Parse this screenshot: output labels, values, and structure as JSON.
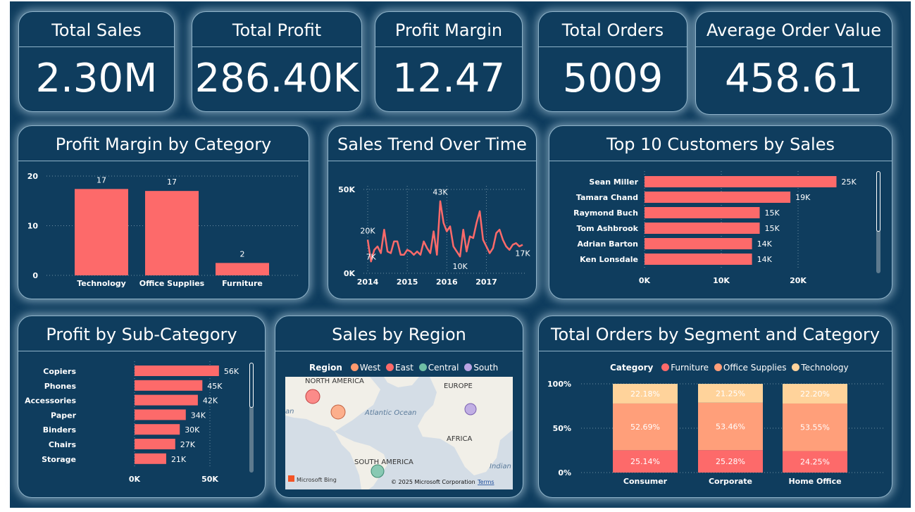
{
  "kpis": [
    {
      "title": "Total Sales",
      "value": "2.30M"
    },
    {
      "title": "Total Profit",
      "value": "286.40K"
    },
    {
      "title": "Profit Margin",
      "value": "12.47"
    },
    {
      "title": "Total Orders",
      "value": "5009"
    },
    {
      "title": "Average Order Value",
      "value": "458.61"
    }
  ],
  "colors": {
    "background": "#0f3d5e",
    "bar": "#fd6a6a",
    "west": "#ff9a6e",
    "east": "#fd6a6a",
    "central": "#6fbfa5",
    "south": "#b9a3e3",
    "office": "#ff9f7a",
    "tech": "#ffd39b"
  },
  "chart_data": [
    {
      "title": "Profit Margin by Category",
      "type": "bar",
      "categories": [
        "Technology",
        "Office Supplies",
        "Furniture"
      ],
      "values": [
        17.4,
        17.0,
        2.5
      ],
      "data_labels": [
        "17",
        "17",
        "2"
      ],
      "yticks": [
        "0",
        "10",
        "20"
      ],
      "ylim": [
        0,
        20
      ]
    },
    {
      "title": "Sales Trend Over Time",
      "type": "line",
      "x": [
        "2014-01",
        "2014-02",
        "2014-03",
        "2014-04",
        "2014-05",
        "2014-06",
        "2014-07",
        "2014-08",
        "2014-09",
        "2014-10",
        "2014-11",
        "2014-12",
        "2015-01",
        "2015-02",
        "2015-03",
        "2015-04",
        "2015-05",
        "2015-06",
        "2015-07",
        "2015-08",
        "2015-09",
        "2015-10",
        "2015-11",
        "2015-12",
        "2016-01",
        "2016-02",
        "2016-03",
        "2016-04",
        "2016-05",
        "2016-06",
        "2016-07",
        "2016-08",
        "2016-09",
        "2016-10",
        "2016-11",
        "2016-12",
        "2017-01",
        "2017-02",
        "2017-03",
        "2017-04",
        "2017-05",
        "2017-06",
        "2017-07",
        "2017-08",
        "2017-09",
        "2017-10",
        "2017-11",
        "2017-12"
      ],
      "values": [
        20,
        7,
        14,
        16,
        12,
        26,
        13,
        12,
        19,
        19,
        11,
        11,
        14,
        13,
        11,
        13,
        11,
        19,
        15,
        12,
        25,
        11,
        43,
        30,
        25,
        28,
        16,
        13,
        10,
        26,
        13,
        22,
        21,
        30,
        37,
        20,
        16,
        12,
        15,
        24,
        26,
        20,
        16,
        14,
        17,
        18,
        16,
        17
      ],
      "data_labels": [
        "20K",
        "7K",
        "43K",
        "10K",
        "17K"
      ],
      "xticks": [
        "2014",
        "2015",
        "2016",
        "2017"
      ],
      "yticks": [
        "0K",
        "50K"
      ],
      "ylim": [
        0,
        50
      ]
    },
    {
      "title": "Top 10 Customers by Sales",
      "type": "bar",
      "orientation": "horizontal",
      "categories": [
        "Sean Miller",
        "Tamara Chand",
        "Raymond Buch",
        "Tom Ashbrook",
        "Adrian Barton",
        "Ken Lonsdale"
      ],
      "values": [
        25,
        19,
        15,
        15,
        14,
        14
      ],
      "data_labels": [
        "25K",
        "19K",
        "15K",
        "15K",
        "14K",
        "14K"
      ],
      "xticks": [
        "0K",
        "10K",
        "20K"
      ],
      "xlim": [
        0,
        25
      ]
    },
    {
      "title": "Profit by Sub-Category",
      "type": "bar",
      "orientation": "horizontal",
      "categories": [
        "Copiers",
        "Phones",
        "Accessories",
        "Paper",
        "Binders",
        "Chairs",
        "Storage"
      ],
      "values": [
        56,
        45,
        42,
        34,
        30,
        27,
        21
      ],
      "data_labels": [
        "56K",
        "45K",
        "42K",
        "34K",
        "30K",
        "27K",
        "21K"
      ],
      "xticks": [
        "0K",
        "50K"
      ],
      "xlim": [
        0,
        50
      ]
    },
    {
      "title": "Total Orders by Segment and Category",
      "type": "bar",
      "stacked": true,
      "legend_title": "Category",
      "categories": [
        "Consumer",
        "Corporate",
        "Home Office"
      ],
      "series": [
        {
          "name": "Furniture",
          "values": [
            25.14,
            25.28,
            24.25
          ],
          "labels": [
            "25.14%",
            "25.28%",
            "24.25%"
          ]
        },
        {
          "name": "Office Supplies",
          "values": [
            52.69,
            53.46,
            53.55
          ],
          "labels": [
            "52.69%",
            "53.46%",
            "53.55%"
          ]
        },
        {
          "name": "Technology",
          "values": [
            22.18,
            21.25,
            22.2
          ],
          "labels": [
            "22.18%",
            "21.25%",
            "22.20%"
          ]
        }
      ],
      "yticks": [
        "0%",
        "50%",
        "100%"
      ],
      "ylim": [
        0,
        100
      ]
    }
  ],
  "region_map": {
    "title": "Sales by Region",
    "legend_title": "Region",
    "legend": [
      "West",
      "East",
      "Central",
      "South"
    ],
    "labels": {
      "north_america": "NORTH AMERICA",
      "europe": "EUROPE",
      "atlantic": "Atlantic Ocean",
      "africa": "AFRICA",
      "south_america": "SOUTH AMERICA",
      "indian": "Indian",
      "edge": "an"
    },
    "attribution": "© 2025 Microsoft Corporation",
    "terms": "Terms",
    "bing": "Microsoft Bing"
  }
}
